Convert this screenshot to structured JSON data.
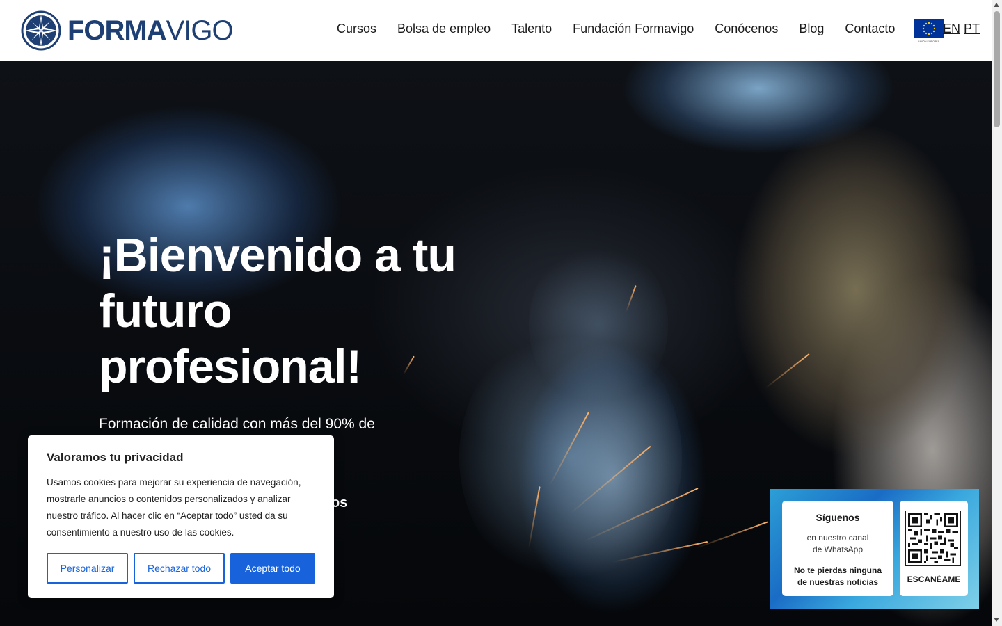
{
  "header": {
    "logo_text_bold": "FORMA",
    "logo_text_light": "VIGO",
    "nav": [
      {
        "label": "Cursos"
      },
      {
        "label": "Bolsa de empleo"
      },
      {
        "label": "Talento"
      },
      {
        "label": "Fundación Formavigo"
      },
      {
        "label": "Conócenos"
      },
      {
        "label": "Blog"
      },
      {
        "label": "Contacto"
      }
    ],
    "eu_flag_caption": "UNIÓN EUROPEA",
    "languages": [
      "EN",
      "PT"
    ]
  },
  "hero": {
    "title": "¡Bienvenido a tu futuro profesional!",
    "subtitle": "Formación de calidad con más del 90% de",
    "subtitle_tail": "os"
  },
  "cookie_banner": {
    "title": "Valoramos tu privacidad",
    "text": "Usamos cookies para mejorar su experiencia de navegación, mostrarle anuncios o contenidos personalizados y analizar nuestro tráfico. Al hacer clic en “Aceptar todo” usted da su consentimiento a nuestro uso de las cookies.",
    "customize_label": "Personalizar",
    "reject_label": "Rechazar todo",
    "accept_label": "Aceptar todo",
    "accent_color": "#1863dc"
  },
  "whatsapp_widget": {
    "title": "Síguenos",
    "line1": "en nuestro canal",
    "line2": "de WhatsApp",
    "bold1": "No te pierdas ninguna",
    "bold2": "de nuestras noticias",
    "scan_label": "ESCANÉAME"
  },
  "colors": {
    "brand_navy": "#1d3f73",
    "eu_blue": "#003399",
    "eu_gold": "#ffcc00"
  }
}
